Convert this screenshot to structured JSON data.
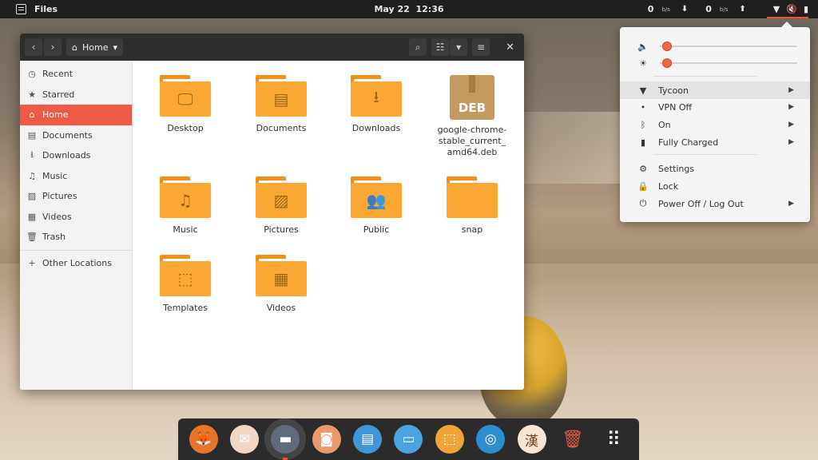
{
  "topbar": {
    "app_name": "Files",
    "date": "May 22",
    "time": "12:36",
    "net_down_value": "0",
    "net_down_unit": "b/s",
    "net_up_value": "0",
    "net_up_unit": "b/s",
    "accent_color": "#e95420"
  },
  "window": {
    "path_label": "Home",
    "sidebar": [
      {
        "label": "Recent",
        "icon": "clock-icon",
        "glyph": "◷"
      },
      {
        "label": "Starred",
        "icon": "star-icon",
        "glyph": "★"
      },
      {
        "label": "Home",
        "icon": "home-icon",
        "glyph": "⌂",
        "active": true
      },
      {
        "label": "Documents",
        "icon": "document-icon",
        "glyph": "▤"
      },
      {
        "label": "Downloads",
        "icon": "download-icon",
        "glyph": "⭳"
      },
      {
        "label": "Music",
        "icon": "music-note-icon",
        "glyph": "♫"
      },
      {
        "label": "Pictures",
        "icon": "picture-icon",
        "glyph": "▨"
      },
      {
        "label": "Videos",
        "icon": "film-icon",
        "glyph": "▦"
      },
      {
        "label": "Trash",
        "icon": "trash-icon",
        "glyph": "🗑"
      },
      {
        "label": "Other Locations",
        "icon": "plus-icon",
        "glyph": "+"
      }
    ],
    "files": [
      {
        "name": "Desktop",
        "type": "folder",
        "icon": "desktop-folder-icon",
        "glyph": "🖵"
      },
      {
        "name": "Documents",
        "type": "folder",
        "icon": "documents-folder-icon",
        "glyph": "▤"
      },
      {
        "name": "Downloads",
        "type": "folder",
        "icon": "downloads-folder-icon",
        "glyph": "⭳"
      },
      {
        "name": "google-chrome-stable_current_amd64.deb",
        "type": "deb",
        "icon": "deb-package-icon",
        "badge": "DEB",
        "lines": [
          "google-chrome-",
          "stable_current_",
          "amd64.deb"
        ]
      },
      {
        "name": "Music",
        "type": "folder",
        "icon": "music-folder-icon",
        "glyph": "♫"
      },
      {
        "name": "Pictures",
        "type": "folder",
        "icon": "pictures-folder-icon",
        "glyph": "▨"
      },
      {
        "name": "Public",
        "type": "folder",
        "icon": "public-folder-icon",
        "glyph": "👥"
      },
      {
        "name": "snap",
        "type": "folder",
        "icon": "folder-icon",
        "glyph": ""
      },
      {
        "name": "Templates",
        "type": "folder",
        "icon": "templates-folder-icon",
        "glyph": "⬚"
      },
      {
        "name": "Videos",
        "type": "folder",
        "icon": "videos-folder-icon",
        "glyph": "▦"
      }
    ]
  },
  "sysmenu": {
    "volume_level": 0.02,
    "brightness_level": 0.02,
    "slider_color": "#ee6a45",
    "items": [
      {
        "label": "Tycoon",
        "icon": "wifi-icon",
        "glyph": "▼",
        "submenu": true,
        "hover": true
      },
      {
        "label": "VPN Off",
        "icon": "vpn-icon",
        "glyph": "⬩",
        "submenu": true
      },
      {
        "label": "On",
        "icon": "bluetooth-icon",
        "glyph": "ᛒ",
        "submenu": true
      },
      {
        "label": "Fully Charged",
        "icon": "battery-icon",
        "glyph": "▮",
        "submenu": true
      },
      {
        "label": "Settings",
        "icon": "gear-icon",
        "glyph": "⚙",
        "submenu": false
      },
      {
        "label": "Lock",
        "icon": "lock-icon",
        "glyph": "🔒",
        "submenu": false
      },
      {
        "label": "Power Off / Log Out",
        "icon": "power-icon",
        "glyph": "⏻",
        "submenu": true
      }
    ]
  },
  "dock": [
    {
      "icon": "firefox-icon",
      "bg": "#e8742a"
    },
    {
      "icon": "mail-icon",
      "bg": "#f1d6c4"
    },
    {
      "icon": "files-icon",
      "bg": "#5f6b78",
      "running": true
    },
    {
      "icon": "speaker-icon",
      "bg": "#e89a6b"
    },
    {
      "icon": "text-editor-icon",
      "bg": "#3f97d8"
    },
    {
      "icon": "remote-desktop-icon",
      "bg": "#4aa3df"
    },
    {
      "icon": "software-center-icon",
      "bg": "#f0a336"
    },
    {
      "icon": "help-icon",
      "bg": "#2e8fcf"
    },
    {
      "icon": "kanji-input-icon",
      "bg": "#f5e6d6"
    },
    {
      "icon": "trash-bin-icon",
      "bg": "transparent"
    },
    {
      "icon": "app-grid-icon",
      "bg": "transparent"
    }
  ]
}
